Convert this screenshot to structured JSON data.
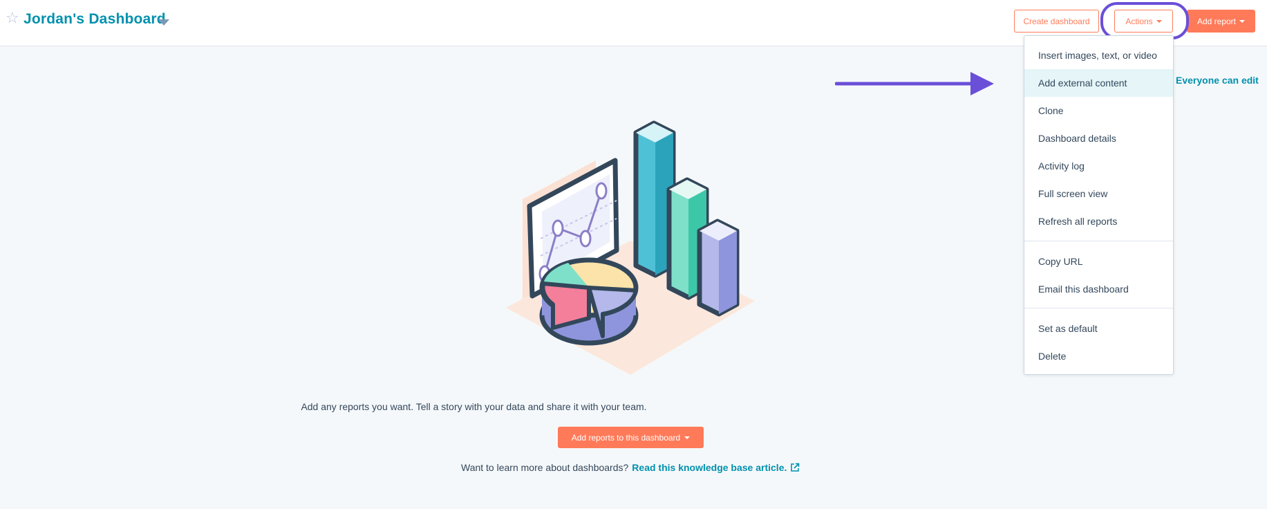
{
  "header": {
    "title": "Jordan's Dashboard",
    "create_dashboard_label": "Create dashboard",
    "actions_label": "Actions",
    "add_report_label": "Add report",
    "sharing_label": "Everyone can edit"
  },
  "actions_menu": {
    "items": [
      {
        "label": "Insert images, text, or video"
      },
      {
        "label": "Add external content"
      },
      {
        "label": "Clone"
      },
      {
        "label": "Dashboard details"
      },
      {
        "label": "Activity log"
      },
      {
        "label": "Full screen view"
      },
      {
        "label": "Refresh all reports"
      },
      {
        "label": "Copy URL"
      },
      {
        "label": "Email this dashboard"
      },
      {
        "label": "Set as default"
      },
      {
        "label": "Delete"
      }
    ],
    "highlighted_item": "Add external content"
  },
  "empty_state": {
    "tagline": "Add any reports you want. Tell a story with your data and share it with your team.",
    "add_reports_label": "Add reports to this dashboard",
    "learn_prefix": "Want to learn more about dashboards?",
    "learn_link": "Read this knowledge base article."
  },
  "icons": {
    "favorite": "star-icon",
    "title_dropdown": "chevron-down-icon",
    "external": "external-link-icon",
    "annotation": "arrow-right-icon"
  },
  "colors": {
    "accent_orange": "#ff7a59",
    "link_teal": "#0091ae",
    "annotation_purple": "#6a4fd8",
    "text_dark": "#33475b",
    "menu_hover": "#e5f5f8"
  }
}
